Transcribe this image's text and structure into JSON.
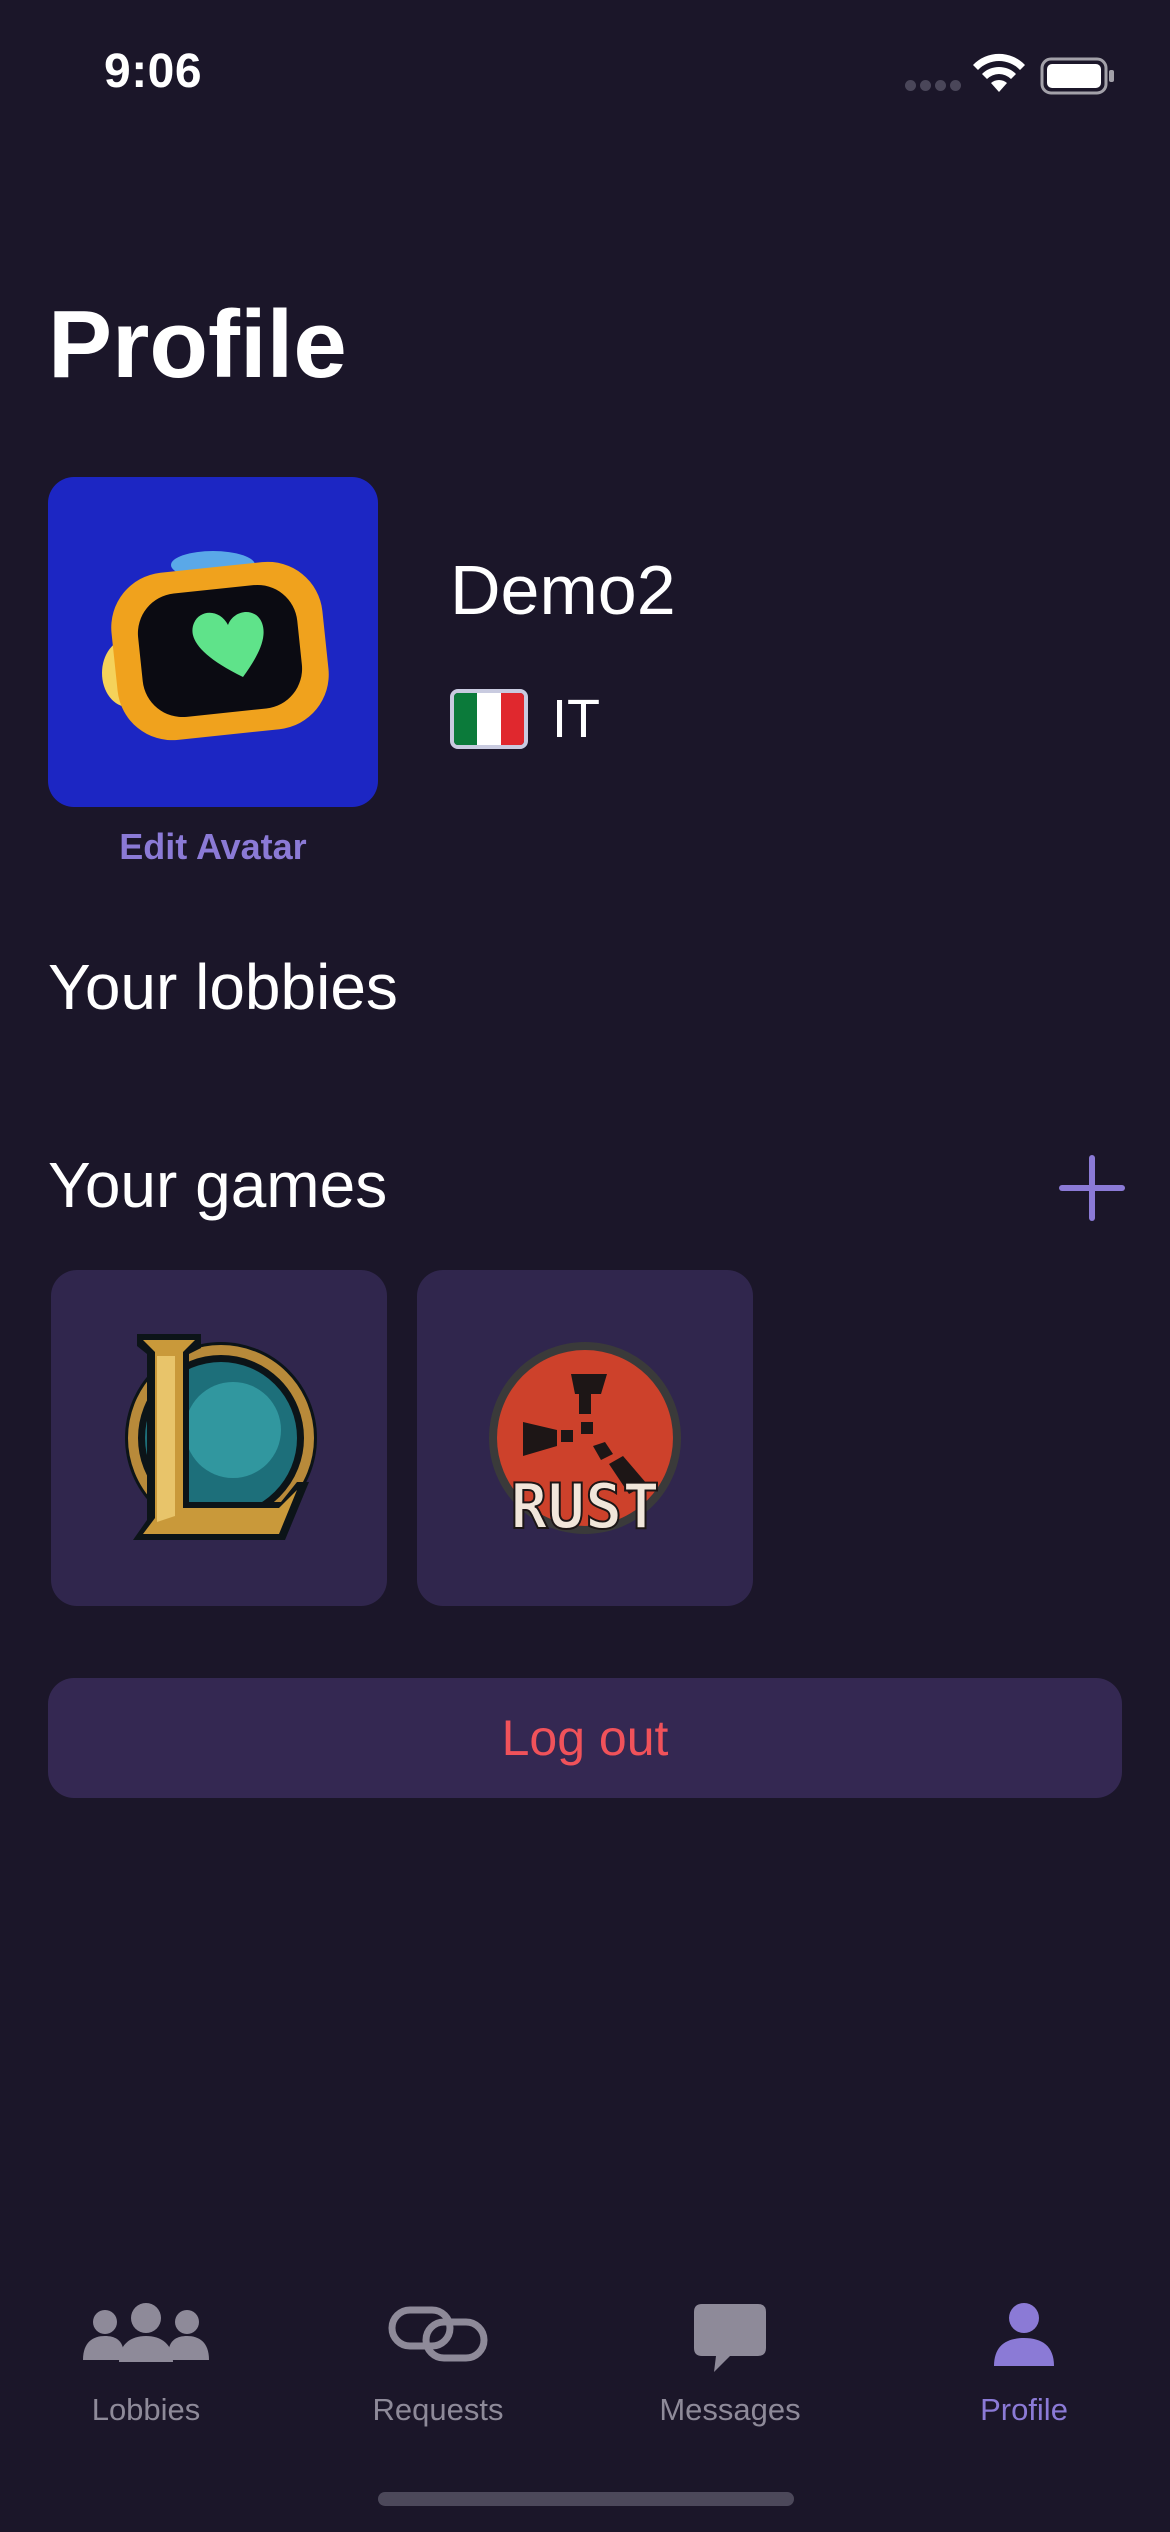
{
  "status_bar": {
    "time": "9:06"
  },
  "header": {
    "title": "Profile"
  },
  "profile": {
    "edit_avatar_label": "Edit Avatar",
    "username": "Demo2",
    "country_code": "IT",
    "avatar_bg": "#1c26c3"
  },
  "sections": {
    "lobbies_title": "Your lobbies",
    "games_title": "Your games"
  },
  "games": [
    {
      "name": "league-of-legends-icon"
    },
    {
      "name": "rust-icon",
      "logo_text": "RUST"
    }
  ],
  "actions": {
    "logout_label": "Log out"
  },
  "tabs": [
    {
      "label": "Lobbies",
      "icon": "group-icon",
      "active": false
    },
    {
      "label": "Requests",
      "icon": "link-icon",
      "active": false
    },
    {
      "label": "Messages",
      "icon": "chat-bubble-icon",
      "active": false
    },
    {
      "label": "Profile",
      "icon": "person-icon",
      "active": true
    }
  ],
  "colors": {
    "background": "#1b1629",
    "accent": "#8b7ad6",
    "card": "#30264d",
    "destructive": "#f0525a"
  }
}
